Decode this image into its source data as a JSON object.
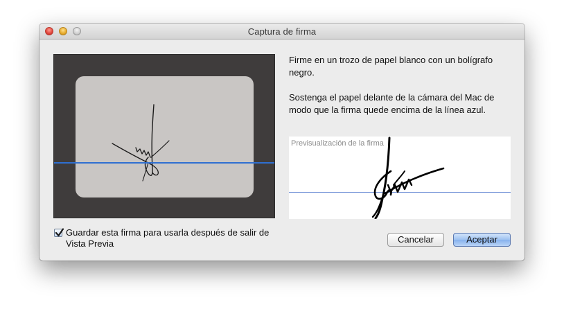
{
  "window": {
    "title": "Captura de firma"
  },
  "camera": {
    "guide_line_color": "#2f6fd1"
  },
  "instructions": [
    "Firme en un trozo de papel blanco con un bolígrafo negro.",
    "Sostenga el papel delante de la cámara del Mac de modo que la firma quede encima de la línea azul."
  ],
  "preview": {
    "label": "Previsualización de la firma",
    "baseline_color": "#6f8fd6"
  },
  "save_option": {
    "label": "Guardar esta firma para usarla después de salir de Vista Previa",
    "checked": true
  },
  "buttons": {
    "cancel": "Cancelar",
    "accept": "Aceptar"
  }
}
